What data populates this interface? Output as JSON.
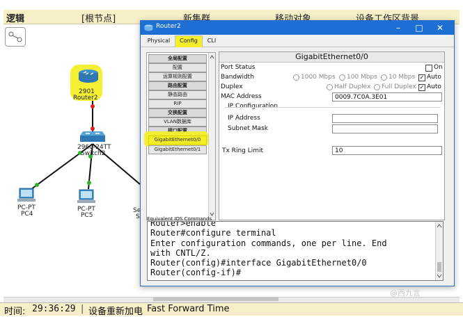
{
  "topbar": {
    "logic": "逻辑",
    "root_node": "[根节点]",
    "new_cluster": "新集群",
    "move_object": "移动对象",
    "set_background": "设备工作区背景"
  },
  "devices": {
    "router": {
      "model": "2901",
      "name": "Router2"
    },
    "switch": {
      "model": "2960-24TT",
      "name": "Switch2"
    },
    "pc4": {
      "model": "PC-PT",
      "name": "PC4"
    },
    "pc5": {
      "model": "PC-PT",
      "name": "PC5"
    },
    "partial": {
      "model": "Se",
      "name": "Se"
    }
  },
  "statusbar": {
    "time_label": "时间:",
    "time_value": "29:36:29",
    "reset": "设备重新加电",
    "fast_forward": "Fast Forward Time"
  },
  "window": {
    "title": "Router2",
    "tabs": [
      "Physical",
      "Config",
      "CLI"
    ],
    "nav_items": [
      {
        "label": "全局配置",
        "header": true
      },
      {
        "label": "配置",
        "header": false
      },
      {
        "label": "运算规则配置",
        "header": false
      },
      {
        "label": "路由配置",
        "header": true
      },
      {
        "label": "静态路由",
        "header": false
      },
      {
        "label": "RIP",
        "header": false
      },
      {
        "label": "交换配置",
        "header": true
      },
      {
        "label": "VLAN数据库",
        "header": false
      },
      {
        "label": "接口配置",
        "header": true
      },
      {
        "label": "GigabitEthernet0/0",
        "header": false,
        "selected": true
      },
      {
        "label": "GigabitEthernet0/1",
        "header": false
      }
    ],
    "panel": {
      "title": "GigabitEthernet0/0",
      "port_status_label": "Port Status",
      "port_on_label": "On",
      "port_on_checked": false,
      "bandwidth_label": "Bandwidth",
      "bw_options": [
        "1000 Mbps",
        "100 Mbps",
        "10 Mbps"
      ],
      "bw_auto_label": "Auto",
      "duplex_label": "Duplex",
      "duplex_options": [
        "Half Duplex",
        "Full Duplex"
      ],
      "duplex_auto_label": "Auto",
      "mac_label": "MAC Address",
      "mac_value": "0009.7C0A.3E01",
      "ipconf_label": "IP Configuration",
      "ip_label": "IP Address",
      "ip_value": "",
      "mask_label": "Subnet Mask",
      "mask_value": "",
      "txring_label": "Tx Ring Limit",
      "txring_value": "10"
    },
    "console": {
      "label": "Equivalent IOS Commands",
      "lines": [
        "Router>enable",
        "Router#configure terminal",
        "Enter configuration commands, one per line.  End",
        "with CNTL/Z.",
        "Router(config)#interface GigabitEthernet0/0",
        "Router(config-if)#"
      ]
    }
  },
  "watermark": "@西九言",
  "colors": {
    "highlight": "#f5ef2a",
    "titlebar": "#1e6fd4",
    "link_up": "#2db52d",
    "link_down": "#e02020"
  }
}
